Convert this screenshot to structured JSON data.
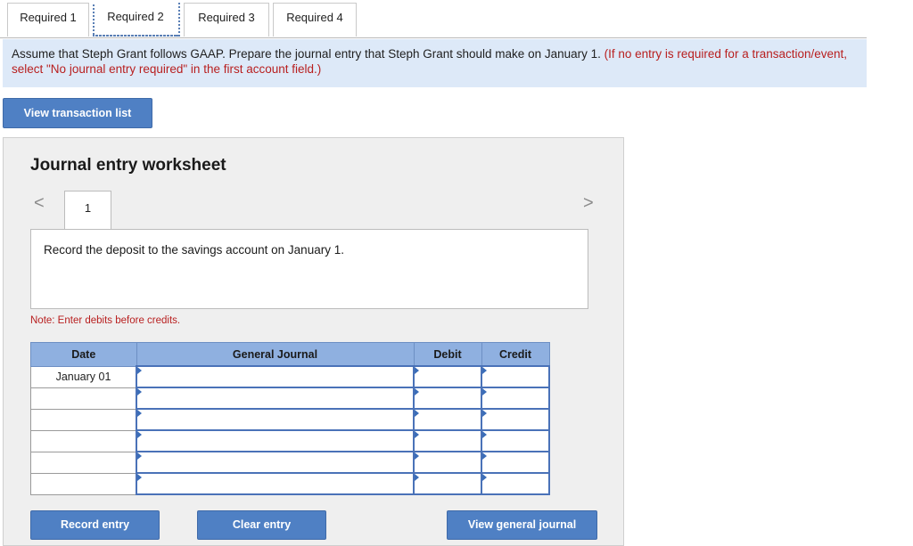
{
  "tabs": [
    "Required 1",
    "Required 2",
    "Required 3",
    "Required 4"
  ],
  "instructions": {
    "text": "Assume that Steph Grant follows GAAP. Prepare the journal entry that Steph Grant should make on January 1. ",
    "note": "(If no entry is required for a transaction/event, select \"No journal entry required\" in the first account field.)"
  },
  "view_transaction_list": "View transaction list",
  "worksheet": {
    "title": "Journal entry worksheet",
    "prev_icon": "<",
    "next_icon": ">",
    "page": "1",
    "description": "Record the deposit to the savings account on January 1.",
    "note": "Note: Enter debits before credits.",
    "columns": [
      "Date",
      "General Journal",
      "Debit",
      "Credit"
    ],
    "rows": [
      {
        "date": "January 01",
        "account": "",
        "debit": "",
        "credit": ""
      },
      {
        "date": "",
        "account": "",
        "debit": "",
        "credit": ""
      },
      {
        "date": "",
        "account": "",
        "debit": "",
        "credit": ""
      },
      {
        "date": "",
        "account": "",
        "debit": "",
        "credit": ""
      },
      {
        "date": "",
        "account": "",
        "debit": "",
        "credit": ""
      },
      {
        "date": "",
        "account": "",
        "debit": "",
        "credit": ""
      }
    ],
    "buttons": {
      "record": "Record entry",
      "clear": "Clear entry",
      "view_journal": "View general journal"
    }
  },
  "colors": {
    "button": "#4f80c4",
    "instructions_bg": "#dde9f8",
    "note_red": "#b81f1f",
    "table_header": "#8fb0e0"
  }
}
